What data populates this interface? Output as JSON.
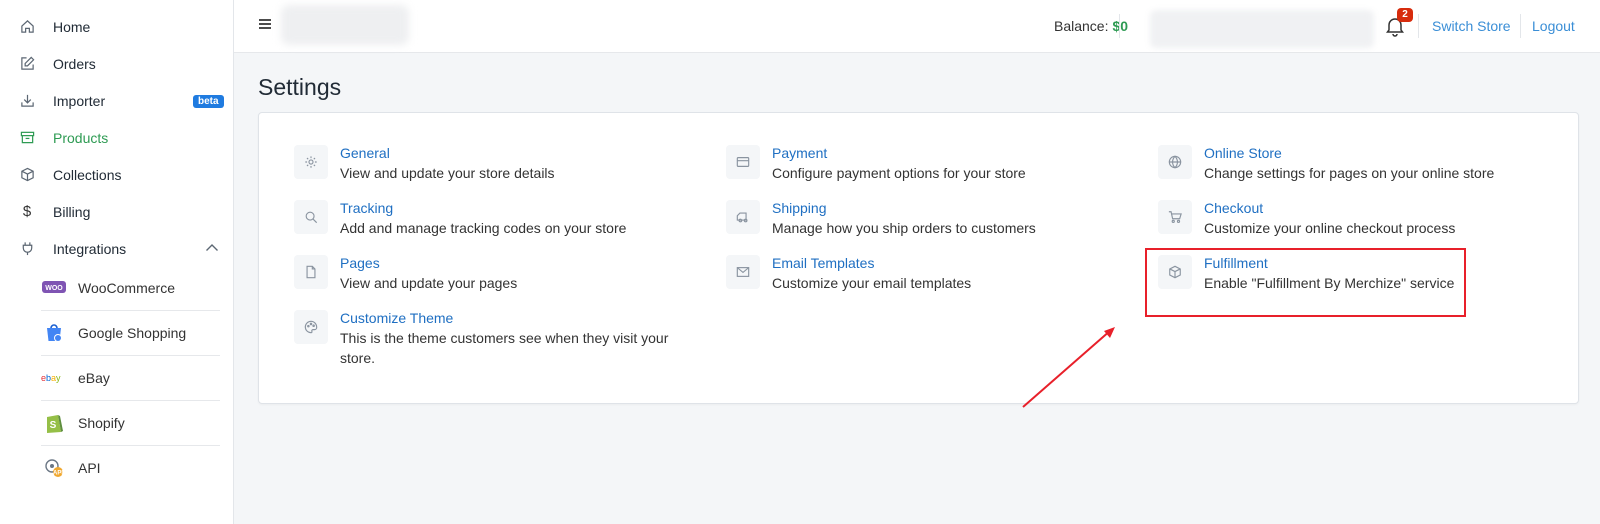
{
  "sidebar": {
    "items": [
      {
        "label": "Home",
        "icon": "home-icon"
      },
      {
        "label": "Orders",
        "icon": "edit-icon"
      },
      {
        "label": "Importer",
        "icon": "download-icon",
        "badge": "beta"
      },
      {
        "label": "Products",
        "icon": "archive-icon",
        "active": true
      },
      {
        "label": "Collections",
        "icon": "box-icon"
      },
      {
        "label": "Billing",
        "icon": "dollar-icon"
      },
      {
        "label": "Integrations",
        "icon": "plug-icon",
        "expanded": true
      }
    ],
    "sub_items": [
      {
        "label": "WooCommerce",
        "icon": "woocommerce-logo"
      },
      {
        "label": "Google Shopping",
        "icon": "google-shopping-logo"
      },
      {
        "label": "eBay",
        "icon": "ebay-logo"
      },
      {
        "label": "Shopify",
        "icon": "shopify-logo"
      },
      {
        "label": "API",
        "icon": "api-logo"
      }
    ]
  },
  "topbar": {
    "balance_label": "Balance:",
    "balance_value": "$0",
    "notification_count": "2",
    "switch_store": "Switch Store",
    "logout": "Logout"
  },
  "main": {
    "title": "Settings",
    "settings": [
      {
        "title": "General",
        "desc": "View and update your store details",
        "icon": "gear-icon"
      },
      {
        "title": "Payment",
        "desc": "Configure payment options for your store",
        "icon": "credit-card-icon"
      },
      {
        "title": "Online Store",
        "desc": "Change settings for pages on your online store",
        "icon": "globe-icon"
      },
      {
        "title": "Tracking",
        "desc": "Add and manage tracking codes on your store",
        "icon": "search-icon"
      },
      {
        "title": "Shipping",
        "desc": "Manage how you ship orders to customers",
        "icon": "truck-icon"
      },
      {
        "title": "Checkout",
        "desc": "Customize your online checkout process",
        "icon": "cart-icon"
      },
      {
        "title": "Pages",
        "desc": "View and update your pages",
        "icon": "file-icon"
      },
      {
        "title": "Email Templates",
        "desc": "Customize your email templates",
        "icon": "mail-icon"
      },
      {
        "title": "Fulfillment",
        "desc": "Enable \"Fulfillment By Merchize\" service",
        "icon": "package-icon"
      },
      {
        "title": "Customize Theme",
        "desc": "This is the theme customers see when they visit your store.",
        "icon": "palette-icon"
      }
    ]
  },
  "colors": {
    "accent_green": "#2e9b53",
    "link_blue": "#1f6fc2",
    "highlight_red": "#e8202a",
    "badge_blue": "#1f7be0"
  }
}
